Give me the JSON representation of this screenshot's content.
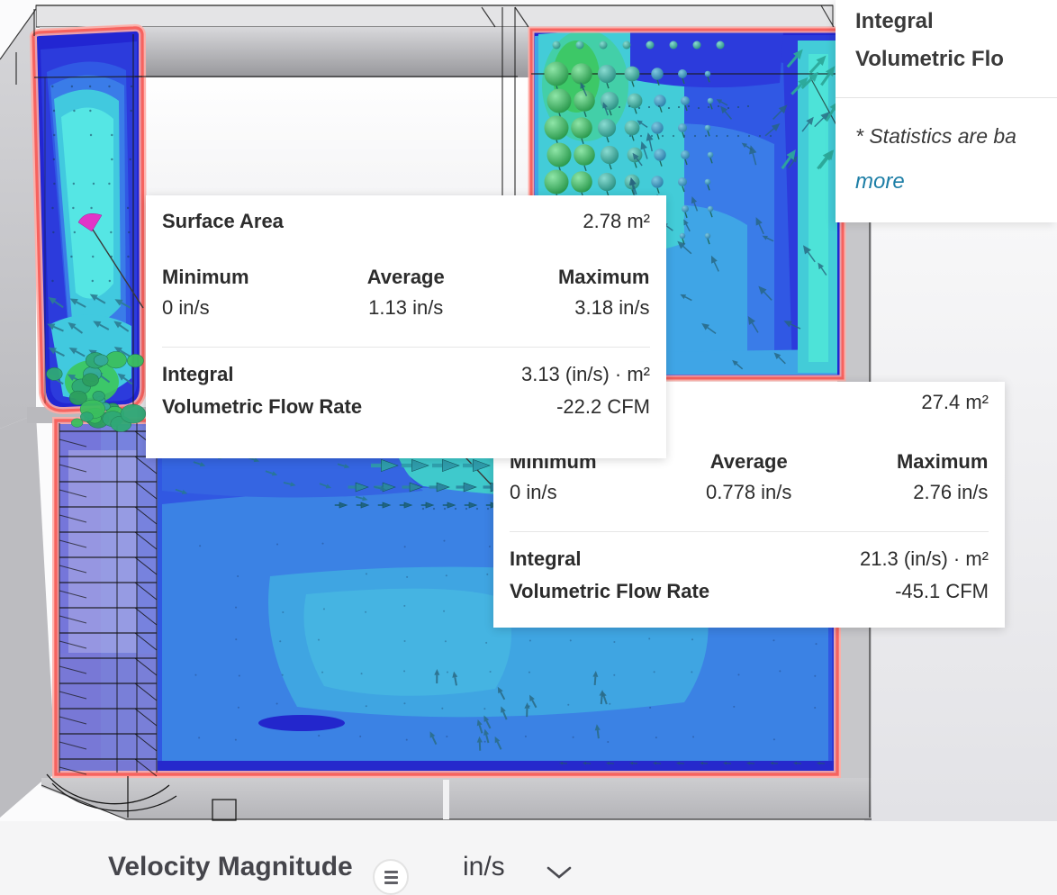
{
  "stats_cards": [
    {
      "surface_area_label": "Surface Area",
      "surface_area_value": "2.78 m²",
      "minimum_label": "Minimum",
      "minimum_value": "0 in/s",
      "average_label": "Average",
      "average_value": "1.13 in/s",
      "maximum_label": "Maximum",
      "maximum_value": "3.18 in/s",
      "integral_label": "Integral",
      "volumetric_label": "Volumetric Flow Rate",
      "integral_value": "3.13 (in/s) · m²",
      "volumetric_value": "-22.2 CFM"
    },
    {
      "surface_area_value": "27.4 m²",
      "minimum_label": "Minimum",
      "minimum_value": "0 in/s",
      "average_label": "Average",
      "average_value": "0.778 in/s",
      "maximum_label": "Maximum",
      "maximum_value": "2.76 in/s",
      "integral_label": "Integral",
      "volumetric_label": "Volumetric Flow Rate",
      "integral_value": "21.3 (in/s) · m²",
      "volumetric_value": "-45.1 CFM"
    }
  ],
  "info_card": {
    "title_line1": "Integral",
    "title_line2": "Volumetric Flo",
    "note": "* Statistics are ba",
    "more_link": "more"
  },
  "legend_bar": {
    "field_name": "Velocity Magnitude",
    "unit": "in/s"
  },
  "colors": {
    "surface_outline_red": "#f6635f",
    "probe_marker_magenta": "#e135c8",
    "link_blue": "#1d7ea6"
  }
}
